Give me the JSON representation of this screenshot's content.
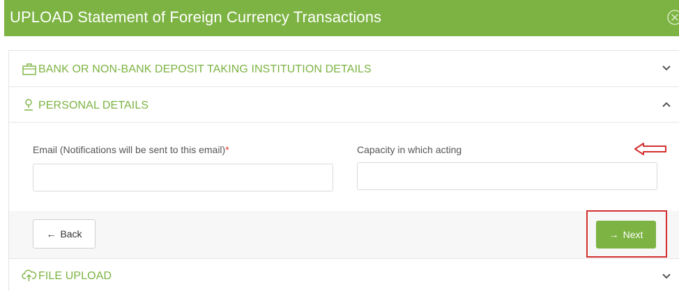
{
  "dialog": {
    "title": "UPLOAD Statement of Foreign Currency Transactions"
  },
  "sections": {
    "bank": {
      "label": "BANK OR NON-BANK DEPOSIT TAKING INSTITUTION DETAILS",
      "icon": "briefcase-icon",
      "state": "collapsed"
    },
    "personal": {
      "label": "PERSONAL DETAILS",
      "icon": "user-icon",
      "state": "expanded"
    },
    "file": {
      "label": "FILE UPLOAD",
      "icon": "cloud-upload-icon",
      "state": "collapsed"
    }
  },
  "form": {
    "email": {
      "label": "Email (Notifications will be sent to this email)",
      "required_mark": "*",
      "value": "",
      "placeholder": ""
    },
    "capacity": {
      "label": "Capacity in which acting",
      "value": "",
      "placeholder": ""
    }
  },
  "buttons": {
    "back": {
      "label": "Back",
      "icon": "arrow-left-icon"
    },
    "next": {
      "label": "Next",
      "icon": "arrow-right-icon"
    }
  },
  "colors": {
    "brand": "#7cb342",
    "annotation": "#d32f2f",
    "required": "#e53935"
  }
}
